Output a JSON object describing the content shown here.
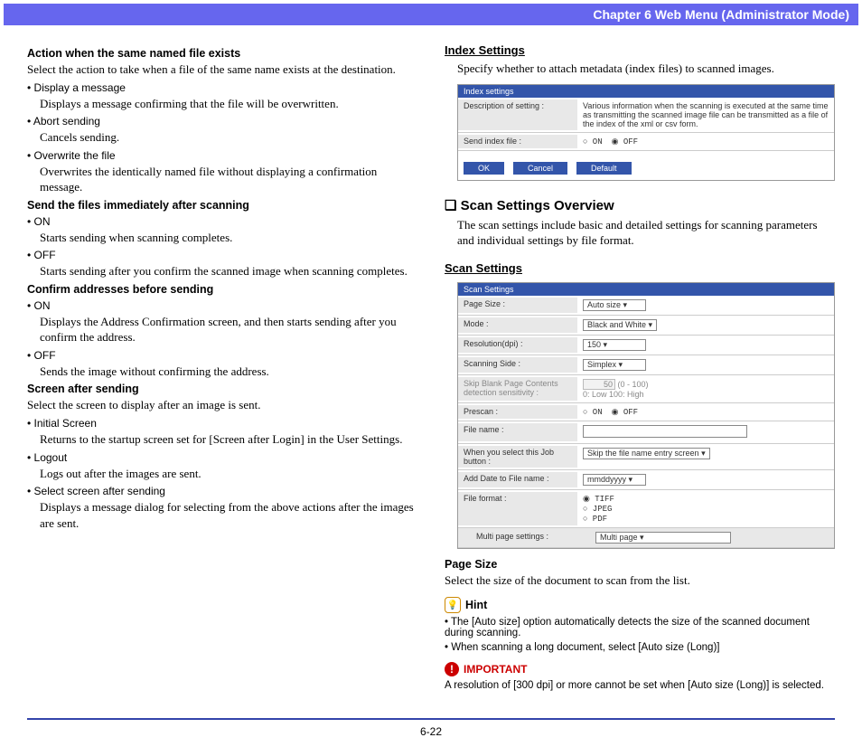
{
  "header": "Chapter 6   Web Menu (Administrator Mode)",
  "footer": "6-22",
  "left": {
    "h1": "Action when the same named file exists",
    "p1": "Select the action to take when a file of the same name exists at the destination.",
    "b1": "• Display a message",
    "b1t": "Displays a message confirming that the file will be overwritten.",
    "b2": "• Abort sending",
    "b2t": "Cancels sending.",
    "b3": "• Overwrite the file",
    "b3t": "Overwrites the identically named file without displaying a confirmation message.",
    "h2": "Send the files immediately after scanning",
    "b4": "• ON",
    "b4t": "Starts sending when scanning completes.",
    "b5": "• OFF",
    "b5t": "Starts sending after you confirm the scanned image when scanning completes.",
    "h3": "Confirm addresses before sending",
    "b6": "• ON",
    "b6t": "Displays the Address Confirmation screen, and then starts sending after you confirm the address.",
    "b7": "• OFF",
    "b7t": "Sends the image without confirming the address.",
    "h4": "Screen after sending",
    "p2": "Select the screen to display after an image is sent.",
    "b8": "• Initial Screen",
    "b8t": "Returns to the startup screen set for [Screen after Login] in the User Settings.",
    "b9": "• Logout",
    "b9t": "Logs out after the images are sent.",
    "b10": "• Select screen after sending",
    "b10t": "Displays a message dialog for selecting from the above actions after the images are sent."
  },
  "right": {
    "h1": "Index Settings",
    "p1": "Specify whether to attach metadata (index files) to scanned images.",
    "ss1": {
      "header": "Index settings",
      "r1l": "Description of setting :",
      "r1v": "Various information when the scanning is executed at the same time as transmitting the scanned image file can be transmitted as a file of the index of the xml or csv form.",
      "r2l": "Send index file :",
      "r2v_on": "○ ON",
      "r2v_off": "◉ OFF",
      "btn_ok": "OK",
      "btn_cancel": "Cancel",
      "btn_default": "Default"
    },
    "h2": "❏ Scan Settings Overview",
    "p2": "The scan settings include basic and detailed settings for scanning parameters and individual settings by file format.",
    "h3": "Scan Settings",
    "ss2": {
      "header": "Scan Settings",
      "r_pagesize_l": "Page Size :",
      "r_pagesize_v": "Auto size",
      "r_mode_l": "Mode :",
      "r_mode_v": "Black and White",
      "r_res_l": "Resolution(dpi) :",
      "r_res_v": "150",
      "r_side_l": "Scanning Side :",
      "r_side_v": "Simplex",
      "r_skip_l": "Skip Blank Page Contents detection sensitivity :",
      "r_skip_v1": "50",
      "r_skip_v1b": "(0 - 100)",
      "r_skip_v2": "0: Low 100: High",
      "r_prescan_l": "Prescan :",
      "r_prescan_on": "○ ON",
      "r_prescan_off": "◉ OFF",
      "r_fname_l": "File name :",
      "r_jobsel_l": "When you select this Job button :",
      "r_jobsel_v": "Skip the file name entry screen",
      "r_adddate_l": "Add Date to File name :",
      "r_adddate_v": "mmddyyyy",
      "r_fmt_l": "File format :",
      "r_fmt_tiff": "◉ TIFF",
      "r_fmt_jpeg": "○ JPEG",
      "r_fmt_pdf": "○ PDF",
      "r_mp_l": "Multi page settings :",
      "r_mp_v": "Multi page"
    },
    "h4": "Page Size",
    "p3": "Select the size of the document to scan from the list.",
    "hint_label": "Hint",
    "hint1": "• The [Auto size] option automatically detects the size of the scanned document during scanning.",
    "hint2": "• When scanning a long document, select [Auto size (Long)]",
    "imp_label": "IMPORTANT",
    "imp_text": "A resolution of [300 dpi] or more cannot be set when [Auto size (Long)] is selected."
  }
}
